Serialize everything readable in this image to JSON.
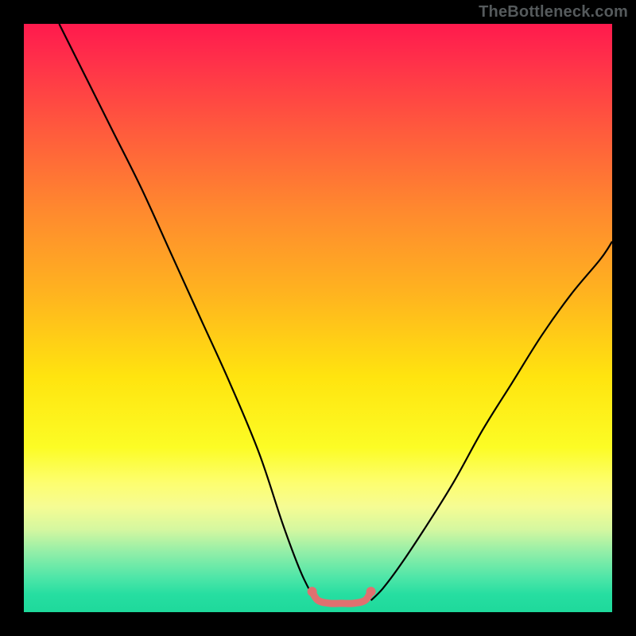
{
  "attribution": "TheBottleneck.com",
  "chart_data": {
    "type": "line",
    "title": "",
    "xlabel": "",
    "ylabel": "",
    "xlim": [
      0,
      100
    ],
    "ylim": [
      0,
      100
    ],
    "grid": false,
    "legend": false,
    "series": [
      {
        "name": "left-curve",
        "color": "#000000",
        "x": [
          6,
          10,
          15,
          20,
          25,
          30,
          35,
          40,
          44,
          47,
          49,
          50
        ],
        "y": [
          100,
          92,
          82,
          72,
          61,
          50,
          39,
          27,
          15,
          7,
          3,
          2
        ]
      },
      {
        "name": "right-curve",
        "color": "#000000",
        "x": [
          59,
          61,
          64,
          68,
          73,
          78,
          83,
          88,
          93,
          98,
          100
        ],
        "y": [
          2,
          4,
          8,
          14,
          22,
          31,
          39,
          47,
          54,
          60,
          63
        ]
      },
      {
        "name": "trough-highlight",
        "color": "#e07070",
        "x": [
          49,
          50,
          52,
          54,
          56,
          58,
          59
        ],
        "y": [
          3.5,
          2,
          1.5,
          1.5,
          1.5,
          2,
          3.5
        ]
      }
    ],
    "gradient_stops": [
      {
        "pct": 0,
        "color": "#ff1a4d"
      },
      {
        "pct": 18,
        "color": "#ff5a3d"
      },
      {
        "pct": 46,
        "color": "#ffb41f"
      },
      {
        "pct": 72,
        "color": "#fcfc25"
      },
      {
        "pct": 86,
        "color": "#d4f7a0"
      },
      {
        "pct": 100,
        "color": "#1ed99b"
      }
    ]
  }
}
